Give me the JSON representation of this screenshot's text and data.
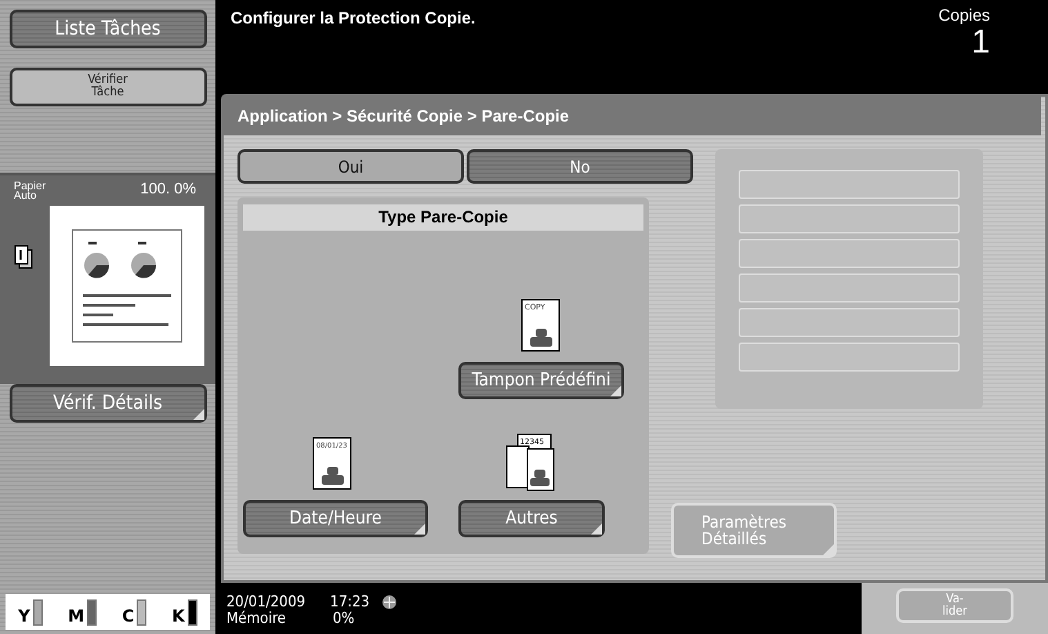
{
  "sidebar": {
    "job_list_button": "Liste Tâches",
    "check_job_button": "Vérifier\nTâche",
    "preview": {
      "paper": "Papier\nAuto",
      "zoom": "100. 0%"
    },
    "check_details_button": "Vérif. Détails",
    "toners": [
      {
        "label": "Y",
        "level": 1
      },
      {
        "label": "M",
        "level": 1
      },
      {
        "label": "C",
        "level": 1
      },
      {
        "label": "K",
        "level": 1
      }
    ]
  },
  "header": {
    "message": "Configurer la Protection Copie.",
    "copies_label": "Copies",
    "copies_value": "1"
  },
  "breadcrumb": "Application > Sécurité Copie > Pare-Copie",
  "toggle": [
    {
      "label": "Oui",
      "selected": false
    },
    {
      "label": "No",
      "selected": true
    }
  ],
  "type_group": {
    "title": "Type Pare-Copie",
    "options": [
      {
        "kind": "preset",
        "label": "Tampon Prédéfini",
        "icon_text": "COPY"
      },
      {
        "kind": "date",
        "label": "Date/Heure",
        "icon_text": "08/01/23"
      },
      {
        "kind": "other",
        "label": "Autres",
        "icon_text": "12345"
      }
    ]
  },
  "detail_settings_button": "Paramètres\nDétaillés",
  "status_bar": {
    "date": "20/01/2009",
    "time": "17:23",
    "memory_label": "Mémoire",
    "memory_value": "0%"
  },
  "confirm_button": "Va-\nlider"
}
